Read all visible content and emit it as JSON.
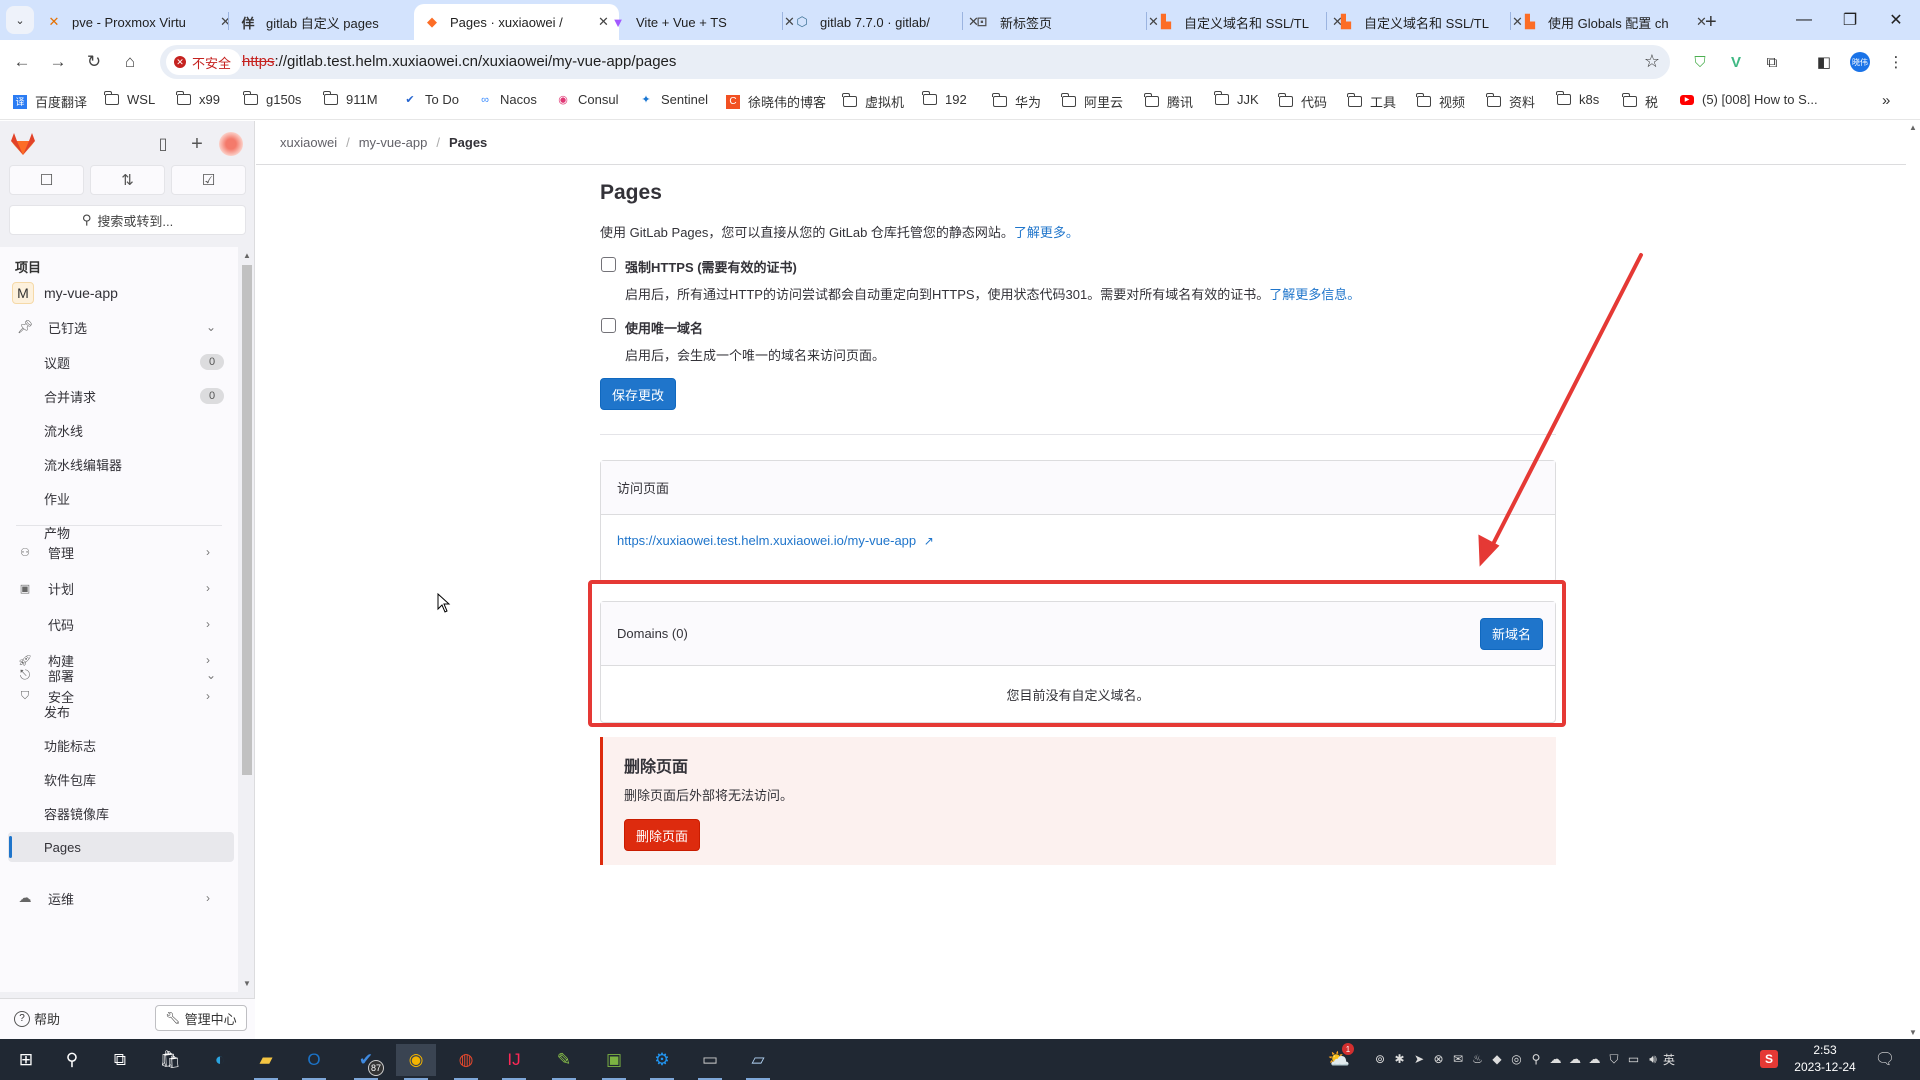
{
  "browser": {
    "tabs": [
      {
        "title": "pve - Proxmox Virtu",
        "icon": "proxmox-icon",
        "active": false
      },
      {
        "title": "gitlab 自定义 pages",
        "icon": "blog-icon",
        "active": false
      },
      {
        "title": "Pages · xuxiaowei / ",
        "icon": "gitlab-icon",
        "active": true
      },
      {
        "title": "Vite + Vue + TS",
        "icon": "vite-icon",
        "active": false
      },
      {
        "title": "gitlab 7.7.0 · gitlab/",
        "icon": "artifacthub-icon",
        "active": false
      },
      {
        "title": "新标签页",
        "icon": "new-tab-icon",
        "active": false
      },
      {
        "title": "自定义域名和 SSL/TL",
        "icon": "docs-icon",
        "active": false
      },
      {
        "title": "自定义域名和 SSL/TL",
        "icon": "docs-icon",
        "active": false
      },
      {
        "title": "使用 Globals 配置 ch",
        "icon": "docs-icon",
        "active": false
      }
    ],
    "new_tab_symbol": "+",
    "security_label": "不安全",
    "url_scheme": "https",
    "url_rest": "://gitlab.test.helm.xuxiaowei.cn/xuxiaowei/my-vue-app/pages",
    "profile_label": "晓伟",
    "bookmarks": [
      {
        "label": "百度翻译",
        "icon": "baidu-translate-icon"
      },
      {
        "label": "WSL",
        "icon": "folder-icon"
      },
      {
        "label": "x99",
        "icon": "folder-icon"
      },
      {
        "label": "g150s",
        "icon": "folder-icon"
      },
      {
        "label": "911M",
        "icon": "folder-icon"
      },
      {
        "label": "To Do",
        "icon": "todo-icon"
      },
      {
        "label": "Nacos",
        "icon": "nacos-icon"
      },
      {
        "label": "Consul",
        "icon": "consul-icon"
      },
      {
        "label": "Sentinel",
        "icon": "sentinel-icon"
      },
      {
        "label": "徐晓伟的博客",
        "icon": "blog-c-icon"
      },
      {
        "label": "虚拟机",
        "icon": "folder-icon"
      },
      {
        "label": "192",
        "icon": "folder-icon"
      },
      {
        "label": "华为",
        "icon": "folder-icon"
      },
      {
        "label": "阿里云",
        "icon": "folder-icon"
      },
      {
        "label": "腾讯",
        "icon": "folder-icon"
      },
      {
        "label": "JJK",
        "icon": "folder-icon"
      },
      {
        "label": "代码",
        "icon": "folder-icon"
      },
      {
        "label": "工具",
        "icon": "folder-icon"
      },
      {
        "label": "视频",
        "icon": "folder-icon"
      },
      {
        "label": "资料",
        "icon": "folder-icon"
      },
      {
        "label": "k8s",
        "icon": "folder-icon"
      },
      {
        "label": "税",
        "icon": "folder-icon"
      },
      {
        "label": "(5) [008] How to S...",
        "icon": "youtube-icon"
      }
    ],
    "more_bookmarks": "»"
  },
  "sidebar": {
    "search_placeholder": "搜索或转到...",
    "section_label": "项目",
    "project": {
      "avatar": "M",
      "name": "my-vue-app"
    },
    "pinned": {
      "label": "已钉选",
      "items": [
        {
          "label": "议题",
          "count": "0"
        },
        {
          "label": "合并请求",
          "count": "0"
        },
        {
          "label": "流水线"
        },
        {
          "label": "流水线编辑器"
        },
        {
          "label": "作业"
        },
        {
          "label": "产物"
        }
      ]
    },
    "groups": [
      {
        "label": "管理",
        "icon": "users-icon"
      },
      {
        "label": "计划",
        "icon": "calendar-icon"
      },
      {
        "label": "代码",
        "icon": "code-icon"
      },
      {
        "label": "构建",
        "icon": "rocket-icon"
      },
      {
        "label": "安全",
        "icon": "shield-icon"
      }
    ],
    "deploy": {
      "label": "部署",
      "items": [
        {
          "label": "发布"
        },
        {
          "label": "功能标志"
        },
        {
          "label": "软件包库"
        },
        {
          "label": "容器镜像库"
        },
        {
          "label": "Pages",
          "active": true
        }
      ]
    },
    "operate": {
      "label": "运维"
    },
    "help_label": "帮助",
    "admin_label": "管理中心"
  },
  "breadcrumb": [
    "xuxiaowei",
    "my-vue-app",
    "Pages"
  ],
  "page": {
    "title": "Pages",
    "intro": "使用 GitLab Pages，您可以直接从您的 GitLab 仓库托管您的静态网站。",
    "intro_link": "了解更多。",
    "force_https": {
      "label": "强制HTTPS (需要有效的证书)",
      "checked": false,
      "help": "启用后，所有通过HTTP的访问尝试都会自动重定向到HTTPS，使用状态代码301。需要对所有域名有效的证书。",
      "help_link": "了解更多信息。"
    },
    "unique_domain": {
      "label": "使用唯一域名",
      "checked": false,
      "help": "启用后，会生成一个唯一的域名来访问页面。"
    },
    "save_label": "保存更改",
    "access": {
      "header": "访问页面",
      "url": "https://xuxiaowei.test.helm.xuxiaowei.io/my-vue-app"
    },
    "domains": {
      "header": "Domains (0)",
      "new_label": "新域名",
      "empty": "您目前没有自定义域名。"
    },
    "danger": {
      "title": "删除页面",
      "desc": "删除页面后外部将无法访问。",
      "button": "删除页面"
    }
  },
  "annotation": {
    "color": "#e53935",
    "target": "domains-card"
  },
  "taskbar": {
    "apps": [
      "start-icon",
      "search-icon",
      "task-view-icon",
      "store-icon",
      "edge-icon",
      "explorer-icon",
      "outlook-icon",
      "todo-icon",
      "chrome-icon",
      "postman-icon",
      "intellij-icon",
      "notepad-icon",
      "android-studio-icon",
      "settings-icon",
      "terminal-icon",
      "notes-icon"
    ],
    "todo_badge": "87",
    "weather_badge": "1",
    "ime_label": "英",
    "time": "2:53",
    "date": "2023-12-24"
  },
  "colors": {
    "accent": "#1f75cb",
    "danger": "#dd2b0e",
    "danger_bg": "#fcf1ef"
  }
}
